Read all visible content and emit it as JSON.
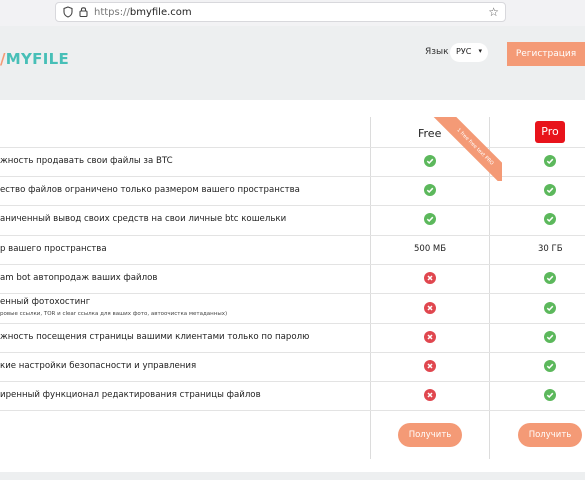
{
  "browser": {
    "url_protocol": "https://",
    "url_host": "bmyfile.com"
  },
  "header": {
    "logo": "MYFILE",
    "lang_label": "Язык :",
    "lang_value": "РУС",
    "register_label": "Регистрация"
  },
  "plans": {
    "free": "Free",
    "pro": "Pro",
    "ribbon": "1 free free text PRO"
  },
  "features": [
    {
      "label": "жность продавать свои файлы за BTC",
      "free": "yes",
      "pro": "yes"
    },
    {
      "label": "ество файлов ограничено только размером вашего пространства",
      "free": "yes",
      "pro": "yes"
    },
    {
      "label": "аниченный вывод своих средств на свои личные btc кошельки",
      "free": "yes",
      "pro": "yes"
    },
    {
      "label": "р вашего пространства",
      "free": "500 МБ",
      "pro": "30 ГБ"
    },
    {
      "label": "am bot автопродаж ваших файлов",
      "free": "no",
      "pro": "yes"
    },
    {
      "label": "енный фотохостинг",
      "sublabel": "ровые ссылки, TOR и clear ссылка для ваших фото, автоочистка метаданных)",
      "free": "no",
      "pro": "yes"
    },
    {
      "label": "жность посещения страницы вашими клиентами только по паролю",
      "free": "no",
      "pro": "yes"
    },
    {
      "label": "кие настройки безопасности и управления",
      "free": "no",
      "pro": "yes"
    },
    {
      "label": "иренный функционал редактирования страницы файлов",
      "free": "no",
      "pro": "yes"
    }
  ],
  "actions": {
    "get_free": "Получить",
    "get_pro": "Получить"
  },
  "colors": {
    "accent": "#f49a76",
    "yes": "#5cb85c",
    "no": "#e0474f",
    "pro_badge": "#e8131b",
    "logo": "#47bfb7"
  }
}
